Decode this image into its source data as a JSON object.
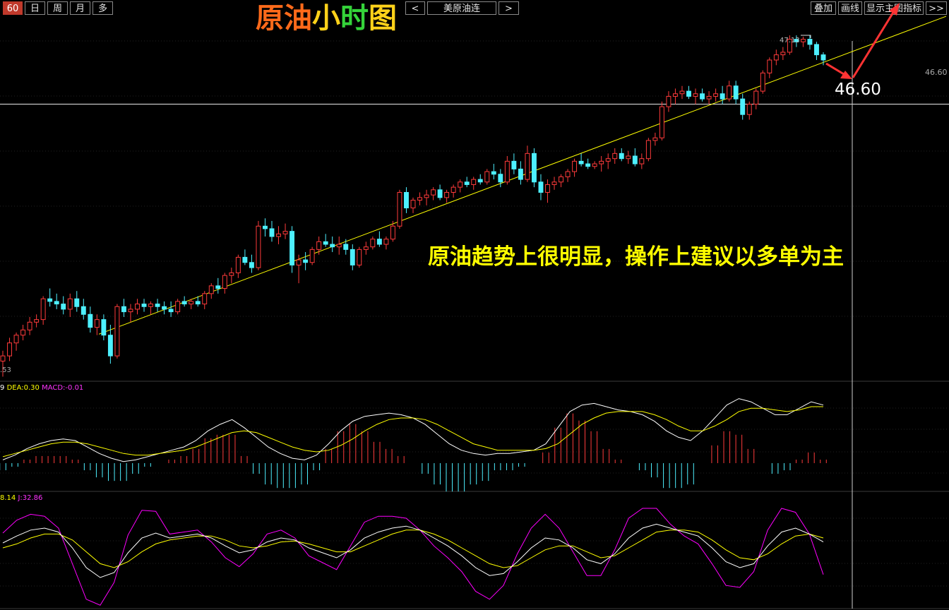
{
  "toolbar": {
    "period_60": "60",
    "period_day": "日",
    "period_week": "周",
    "period_month": "月",
    "period_more": "多",
    "prev": "<",
    "symbol": "美原油连",
    "next": ">",
    "overlay": "叠加",
    "draw": "画线",
    "show_main": "显示主图指标",
    "expand": ">>"
  },
  "title": {
    "part1": "原油",
    "part2": "小",
    "part3": "时",
    "part4": "图"
  },
  "annotation": "原油趋势上很明显，操作上建议以多单为主",
  "price_callout": "46.60",
  "price_axis_label": "46.60",
  "price_min_label": ".53",
  "price_max_label": "47.13",
  "macd_legend": {
    "dif_tail": "9",
    "dea": "DEA:0.30",
    "macd": "MACD:-0.01"
  },
  "kdj_legend": {
    "d_tail": "8.14",
    "j": "J:32.86"
  },
  "colors": {
    "up": "#ff3b3b",
    "down": "#4df0ff",
    "trend": "#ffff00",
    "arrow": "#ff3333",
    "dif": "#ffffff",
    "dea": "#ffff00",
    "j": "#ff00ff"
  },
  "chart_data": {
    "type": "candlestick",
    "ylim": [
      44.53,
      47.25
    ],
    "candles": [
      [
        44.62,
        44.7,
        44.5,
        44.66
      ],
      [
        44.66,
        44.8,
        44.62,
        44.76
      ],
      [
        44.76,
        44.84,
        44.7,
        44.82
      ],
      [
        44.82,
        44.9,
        44.78,
        44.86
      ],
      [
        44.86,
        44.96,
        44.82,
        44.92
      ],
      [
        44.92,
        44.98,
        44.88,
        44.94
      ],
      [
        44.94,
        45.12,
        44.9,
        45.1
      ],
      [
        45.1,
        45.18,
        45.04,
        45.08
      ],
      [
        45.08,
        45.14,
        45.02,
        45.06
      ],
      [
        45.06,
        45.12,
        44.98,
        45.02
      ],
      [
        45.02,
        45.14,
        44.96,
        45.1
      ],
      [
        45.1,
        45.16,
        45.0,
        45.04
      ],
      [
        45.04,
        45.1,
        44.94,
        44.98
      ],
      [
        44.98,
        45.04,
        44.84,
        44.88
      ],
      [
        44.88,
        44.98,
        44.82,
        44.94
      ],
      [
        44.94,
        44.98,
        44.78,
        44.82
      ],
      [
        44.82,
        44.9,
        44.6,
        44.66
      ],
      [
        44.66,
        45.06,
        44.64,
        45.04
      ],
      [
        45.04,
        45.1,
        44.96,
        45.0
      ],
      [
        45.0,
        45.06,
        44.92,
        45.02
      ],
      [
        45.02,
        45.1,
        44.98,
        45.06
      ],
      [
        45.06,
        45.1,
        45.0,
        45.04
      ],
      [
        45.04,
        45.08,
        44.98,
        45.06
      ],
      [
        45.06,
        45.1,
        45.0,
        45.04
      ],
      [
        45.04,
        45.08,
        44.98,
        45.02
      ],
      [
        45.02,
        45.08,
        44.96,
        45.0
      ],
      [
        45.0,
        45.1,
        44.98,
        45.08
      ],
      [
        45.08,
        45.12,
        45.04,
        45.06
      ],
      [
        45.06,
        45.1,
        45.02,
        45.08
      ],
      [
        45.08,
        45.12,
        45.04,
        45.06
      ],
      [
        45.06,
        45.16,
        45.02,
        45.14
      ],
      [
        45.14,
        45.22,
        45.1,
        45.2
      ],
      [
        45.2,
        45.26,
        45.14,
        45.18
      ],
      [
        45.18,
        45.3,
        45.14,
        45.28
      ],
      [
        45.28,
        45.34,
        45.22,
        45.3
      ],
      [
        45.3,
        45.44,
        45.26,
        45.42
      ],
      [
        45.42,
        45.48,
        45.36,
        45.38
      ],
      [
        45.38,
        45.44,
        45.3,
        45.34
      ],
      [
        45.34,
        45.7,
        45.32,
        45.66
      ],
      [
        45.66,
        45.72,
        45.58,
        45.64
      ],
      [
        45.64,
        45.7,
        45.54,
        45.58
      ],
      [
        45.58,
        45.66,
        45.52,
        45.6
      ],
      [
        45.6,
        45.68,
        45.56,
        45.62
      ],
      [
        45.62,
        45.66,
        45.3,
        45.36
      ],
      [
        45.36,
        45.44,
        45.22,
        45.4
      ],
      [
        45.4,
        45.46,
        45.32,
        45.38
      ],
      [
        45.38,
        45.5,
        45.36,
        45.48
      ],
      [
        45.48,
        45.58,
        45.44,
        45.54
      ],
      [
        45.54,
        45.6,
        45.5,
        45.52
      ],
      [
        45.52,
        45.58,
        45.46,
        45.5
      ],
      [
        45.5,
        45.58,
        45.44,
        45.52
      ],
      [
        45.52,
        45.56,
        45.44,
        45.48
      ],
      [
        45.48,
        45.52,
        45.32,
        45.36
      ],
      [
        45.36,
        45.5,
        45.34,
        45.48
      ],
      [
        45.48,
        45.54,
        45.44,
        45.5
      ],
      [
        45.5,
        45.58,
        45.48,
        45.56
      ],
      [
        45.56,
        45.62,
        45.5,
        45.52
      ],
      [
        45.52,
        45.58,
        45.48,
        45.56
      ],
      [
        45.56,
        45.7,
        45.54,
        45.66
      ],
      [
        45.66,
        45.94,
        45.64,
        45.92
      ],
      [
        45.92,
        45.96,
        45.76,
        45.8
      ],
      [
        45.8,
        45.88,
        45.76,
        45.86
      ],
      [
        45.86,
        45.92,
        45.82,
        45.88
      ],
      [
        45.88,
        45.94,
        45.82,
        45.9
      ],
      [
        45.9,
        45.96,
        45.86,
        45.94
      ],
      [
        45.94,
        45.98,
        45.86,
        45.88
      ],
      [
        45.88,
        45.94,
        45.84,
        45.92
      ],
      [
        45.92,
        45.98,
        45.88,
        45.96
      ],
      [
        45.96,
        46.02,
        45.92,
        46.0
      ],
      [
        46.0,
        46.04,
        45.96,
        45.98
      ],
      [
        45.98,
        46.04,
        45.94,
        46.02
      ],
      [
        46.02,
        46.06,
        45.98,
        46.0
      ],
      [
        46.0,
        46.1,
        45.98,
        46.08
      ],
      [
        46.08,
        46.14,
        46.02,
        46.06
      ],
      [
        46.06,
        46.1,
        45.96,
        46.0
      ],
      [
        46.0,
        46.2,
        45.98,
        46.16
      ],
      [
        46.16,
        46.22,
        46.06,
        46.1
      ],
      [
        46.1,
        46.16,
        45.98,
        46.02
      ],
      [
        46.02,
        46.28,
        46.0,
        46.22
      ],
      [
        46.22,
        46.26,
        45.96,
        46.0
      ],
      [
        46.0,
        46.06,
        45.86,
        45.92
      ],
      [
        45.92,
        46.02,
        45.84,
        45.98
      ],
      [
        45.98,
        46.04,
        45.94,
        46.0
      ],
      [
        46.0,
        46.06,
        45.96,
        46.04
      ],
      [
        46.04,
        46.1,
        46.0,
        46.08
      ],
      [
        46.08,
        46.18,
        46.04,
        46.16
      ],
      [
        46.16,
        46.22,
        46.12,
        46.14
      ],
      [
        46.14,
        46.18,
        46.1,
        46.12
      ],
      [
        46.12,
        46.16,
        46.1,
        46.14
      ],
      [
        46.14,
        46.2,
        46.08,
        46.16
      ],
      [
        46.16,
        46.22,
        46.1,
        46.18
      ],
      [
        46.18,
        46.26,
        46.14,
        46.22
      ],
      [
        46.22,
        46.26,
        46.16,
        46.18
      ],
      [
        46.18,
        46.24,
        46.14,
        46.2
      ],
      [
        46.2,
        46.26,
        46.12,
        46.14
      ],
      [
        46.14,
        46.22,
        46.1,
        46.18
      ],
      [
        46.18,
        46.34,
        46.16,
        46.32
      ],
      [
        46.32,
        46.38,
        46.28,
        46.34
      ],
      [
        46.34,
        46.62,
        46.32,
        46.58
      ],
      [
        46.58,
        46.7,
        46.54,
        46.66
      ],
      [
        46.66,
        46.72,
        46.6,
        46.68
      ],
      [
        46.68,
        46.74,
        46.64,
        46.7
      ],
      [
        46.7,
        46.74,
        46.64,
        46.66
      ],
      [
        46.66,
        46.72,
        46.6,
        46.68
      ],
      [
        46.68,
        46.72,
        46.62,
        46.64
      ],
      [
        46.64,
        46.7,
        46.6,
        46.66
      ],
      [
        46.66,
        46.72,
        46.62,
        46.68
      ],
      [
        46.68,
        46.74,
        46.6,
        46.64
      ],
      [
        46.64,
        46.78,
        46.62,
        46.74
      ],
      [
        46.74,
        46.78,
        46.6,
        46.64
      ],
      [
        46.64,
        46.68,
        46.48,
        46.52
      ],
      [
        46.52,
        46.62,
        46.48,
        46.6
      ],
      [
        46.6,
        46.72,
        46.56,
        46.7
      ],
      [
        46.7,
        46.86,
        46.68,
        46.84
      ],
      [
        46.84,
        46.96,
        46.8,
        46.94
      ],
      [
        46.94,
        47.02,
        46.9,
        46.98
      ],
      [
        46.98,
        47.04,
        46.94,
        47.0
      ],
      [
        47.0,
        47.13,
        46.98,
        47.1
      ],
      [
        47.1,
        47.13,
        47.04,
        47.08
      ],
      [
        47.08,
        47.12,
        47.04,
        47.1
      ],
      [
        47.1,
        47.13,
        47.02,
        47.06
      ],
      [
        47.06,
        47.08,
        46.94,
        46.98
      ],
      [
        46.98,
        47.0,
        46.9,
        46.94
      ]
    ],
    "trendline": [
      [
        0,
        44.55
      ],
      [
        125,
        46.98
      ]
    ],
    "horizontal_level": 46.6,
    "macd": {
      "dif": [
        0.02,
        0.05,
        0.09,
        0.12,
        0.14,
        0.15,
        0.14,
        0.1,
        0.06,
        0.03,
        0.01,
        0.02,
        0.04,
        0.06,
        0.08,
        0.1,
        0.14,
        0.2,
        0.24,
        0.27,
        0.22,
        0.16,
        0.1,
        0.06,
        0.03,
        0.02,
        0.05,
        0.12,
        0.2,
        0.26,
        0.29,
        0.3,
        0.31,
        0.3,
        0.28,
        0.24,
        0.18,
        0.12,
        0.08,
        0.06,
        0.05,
        0.06,
        0.06,
        0.07,
        0.08,
        0.12,
        0.22,
        0.32,
        0.36,
        0.37,
        0.35,
        0.33,
        0.32,
        0.3,
        0.26,
        0.2,
        0.16,
        0.14,
        0.2,
        0.28,
        0.36,
        0.4,
        0.38,
        0.34,
        0.3,
        0.3,
        0.34,
        0.38,
        0.36
      ],
      "dea": [
        0.04,
        0.06,
        0.08,
        0.1,
        0.12,
        0.13,
        0.13,
        0.12,
        0.1,
        0.08,
        0.06,
        0.05,
        0.05,
        0.06,
        0.07,
        0.08,
        0.1,
        0.13,
        0.16,
        0.19,
        0.2,
        0.19,
        0.16,
        0.13,
        0.1,
        0.08,
        0.07,
        0.08,
        0.11,
        0.15,
        0.2,
        0.24,
        0.27,
        0.28,
        0.28,
        0.27,
        0.24,
        0.2,
        0.16,
        0.12,
        0.1,
        0.08,
        0.08,
        0.08,
        0.08,
        0.09,
        0.12,
        0.18,
        0.24,
        0.28,
        0.31,
        0.32,
        0.32,
        0.32,
        0.3,
        0.27,
        0.23,
        0.2,
        0.2,
        0.23,
        0.27,
        0.32,
        0.34,
        0.34,
        0.33,
        0.32,
        0.33,
        0.35,
        0.35
      ],
      "hist": [
        -0.02,
        -0.01,
        0.01,
        0.02,
        0.02,
        0.02,
        0.01,
        -0.02,
        -0.04,
        -0.05,
        -0.05,
        -0.03,
        -0.01,
        0.0,
        0.01,
        0.02,
        0.04,
        0.07,
        0.08,
        0.08,
        0.02,
        -0.03,
        -0.06,
        -0.07,
        -0.07,
        -0.06,
        -0.02,
        0.04,
        0.09,
        0.11,
        0.09,
        0.06,
        0.04,
        0.02,
        0.0,
        -0.03,
        -0.06,
        -0.08,
        -0.08,
        -0.06,
        -0.05,
        -0.02,
        -0.02,
        -0.01,
        0.0,
        0.03,
        0.1,
        0.14,
        0.12,
        0.09,
        0.04,
        0.01,
        0.0,
        -0.02,
        -0.04,
        -0.07,
        -0.07,
        -0.06,
        0.0,
        0.05,
        0.09,
        0.08,
        0.04,
        0.0,
        -0.03,
        -0.02,
        0.01,
        0.03,
        0.01
      ]
    },
    "kdj": {
      "k": [
        65,
        72,
        78,
        80,
        76,
        60,
        40,
        30,
        35,
        55,
        70,
        75,
        70,
        72,
        74,
        70,
        62,
        55,
        58,
        66,
        70,
        68,
        60,
        55,
        50,
        58,
        70,
        76,
        80,
        82,
        78,
        70,
        62,
        52,
        40,
        32,
        34,
        46,
        60,
        70,
        68,
        60,
        48,
        44,
        54,
        70,
        80,
        84,
        80,
        76,
        72,
        60,
        46,
        40,
        44,
        62,
        76,
        80,
        74,
        66
      ],
      "d": [
        60,
        64,
        70,
        74,
        74,
        68,
        56,
        44,
        40,
        46,
        56,
        64,
        68,
        70,
        72,
        72,
        68,
        62,
        60,
        62,
        66,
        67,
        64,
        60,
        56,
        56,
        62,
        68,
        74,
        78,
        78,
        74,
        68,
        60,
        52,
        44,
        40,
        42,
        50,
        58,
        62,
        62,
        56,
        50,
        52,
        60,
        68,
        76,
        78,
        78,
        76,
        68,
        58,
        50,
        48,
        54,
        64,
        72,
        74,
        70
      ],
      "j": [
        75,
        88,
        94,
        92,
        80,
        44,
        8,
        2,
        25,
        73,
        98,
        97,
        74,
        76,
        78,
        66,
        50,
        41,
        54,
        74,
        78,
        70,
        52,
        45,
        38,
        62,
        86,
        92,
        92,
        90,
        78,
        62,
        50,
        36,
        16,
        8,
        22,
        54,
        80,
        94,
        80,
        56,
        32,
        32,
        58,
        90,
        100,
        100,
        84,
        72,
        64,
        44,
        22,
        20,
        36,
        78,
        100,
        96,
        74,
        33
      ]
    }
  }
}
